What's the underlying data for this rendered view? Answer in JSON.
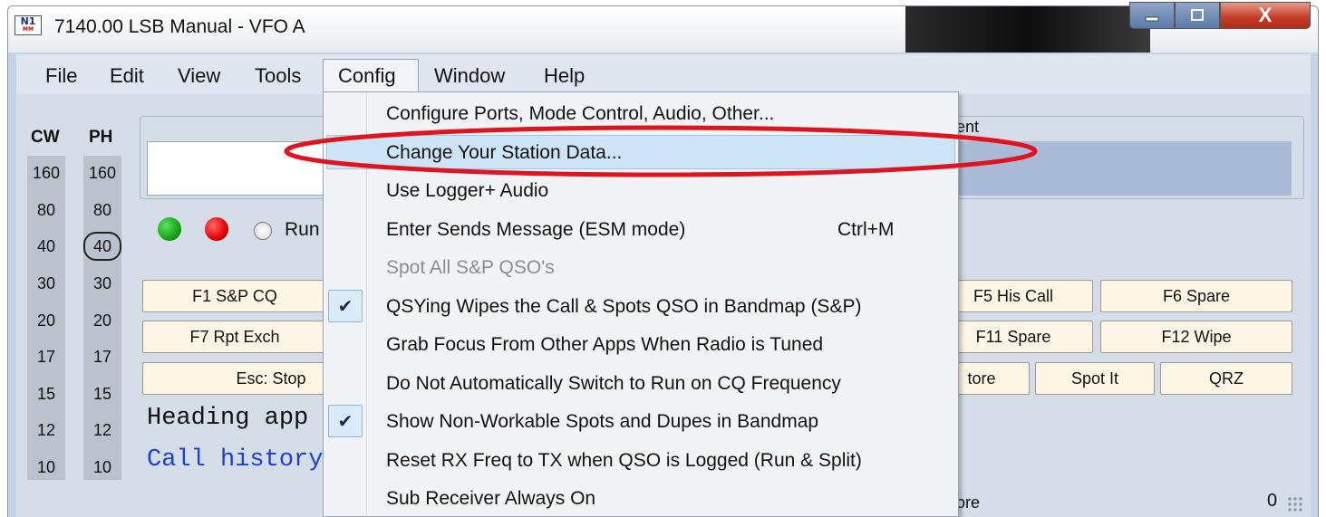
{
  "window": {
    "title": "7140.00 LSB Manual - VFO A",
    "icon_text": "N1",
    "icon_subtext": "MM",
    "close_glyph": "X"
  },
  "menubar": {
    "items": [
      "File",
      "Edit",
      "View",
      "Tools",
      "Config",
      "Window",
      "Help"
    ]
  },
  "bands": {
    "cw_header": "CW",
    "ph_header": "PH",
    "cw": [
      "160",
      "80",
      "40",
      "30",
      "20",
      "17",
      "15",
      "12",
      "10"
    ],
    "ph": [
      "160",
      "80",
      "40",
      "30",
      "20",
      "17",
      "15",
      "12",
      "10"
    ],
    "selected_ph": "40"
  },
  "main": {
    "ent_label": "ent",
    "run_label": "Run",
    "fkeys": {
      "f1": "F1 S&P CQ",
      "f5": "F5 His Call",
      "f6": "F6 Spare",
      "f7": "F7 Rpt Exch",
      "f11": "F11 Spare",
      "f12": "F12 Wipe",
      "esc": "Esc: Stop",
      "store": "tore",
      "spot": "Spot It",
      "qrz": "QRZ"
    },
    "heading_line": "Heading app",
    "history_line": "Call history",
    "status_more": "ore",
    "status_count": "0"
  },
  "config_menu": {
    "items": [
      {
        "label": "Configure Ports, Mode Control, Audio, Other...",
        "checked": false,
        "enabled": true
      },
      {
        "label": "Change Your Station Data...",
        "checked": false,
        "enabled": true,
        "highlighted": true
      },
      {
        "label": "Use Logger+ Audio",
        "checked": false,
        "enabled": true
      },
      {
        "label": "Enter Sends Message (ESM mode)",
        "shortcut": "Ctrl+M",
        "checked": false,
        "enabled": true
      },
      {
        "label": "Spot All S&P QSO's",
        "checked": false,
        "enabled": false
      },
      {
        "label": "QSYing Wipes the Call & Spots QSO in Bandmap (S&P)",
        "checked": true,
        "enabled": true
      },
      {
        "label": "Grab Focus From Other Apps When Radio is Tuned",
        "checked": false,
        "enabled": true
      },
      {
        "label": "Do Not Automatically Switch to Run on CQ Frequency",
        "checked": false,
        "enabled": true
      },
      {
        "label": "Show Non-Workable Spots and Dupes in Bandmap",
        "checked": true,
        "enabled": true
      },
      {
        "label": "Reset RX Freq to TX when QSO is Logged (Run & Split)",
        "checked": false,
        "enabled": true
      },
      {
        "label": "Sub Receiver Always On",
        "checked": false,
        "enabled": true
      }
    ]
  },
  "colors": {
    "annotation_ellipse": "#e0141e",
    "highlight": "#cde4f7",
    "history_text": "#1c3fd6"
  }
}
